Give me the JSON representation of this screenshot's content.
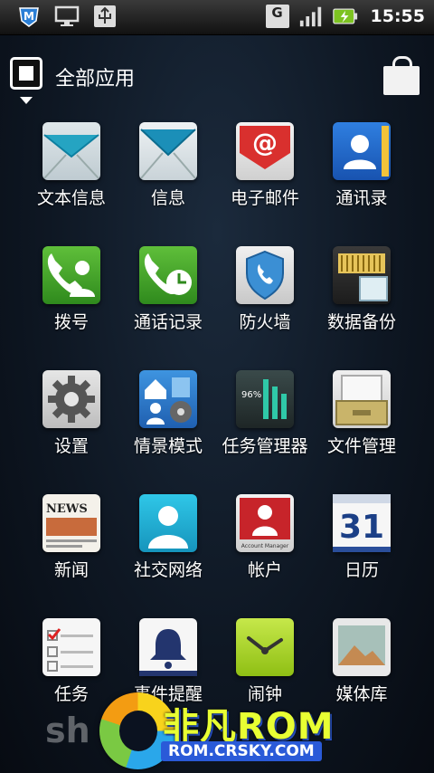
{
  "status_bar": {
    "clock": "15:55",
    "network_badge": "G",
    "icons": [
      "moto-m-icon",
      "monitor-icon",
      "usb-icon",
      "g-network-icon",
      "signal-icon",
      "battery-charging-icon"
    ]
  },
  "header": {
    "title": "全部应用"
  },
  "apps": [
    {
      "label": "文本信息",
      "icon": "envelope-teal-icon"
    },
    {
      "label": "信息",
      "icon": "envelope-icon"
    },
    {
      "label": "电子邮件",
      "icon": "email-at-icon"
    },
    {
      "label": "通讯录",
      "icon": "contacts-book-icon"
    },
    {
      "label": "拨号",
      "icon": "phone-dialer-icon"
    },
    {
      "label": "通话记录",
      "icon": "call-log-icon"
    },
    {
      "label": "防火墙",
      "icon": "firewall-shield-icon"
    },
    {
      "label": "数据备份",
      "icon": "sd-card-backup-icon"
    },
    {
      "label": "设置",
      "icon": "settings-gear-icon"
    },
    {
      "label": "情景模式",
      "icon": "profiles-icon"
    },
    {
      "label": "任务管理器",
      "icon": "task-manager-icon"
    },
    {
      "label": "文件管理",
      "icon": "file-drawer-icon"
    },
    {
      "label": "新闻",
      "icon": "news-icon"
    },
    {
      "label": "社交网络",
      "icon": "social-network-icon"
    },
    {
      "label": "帐户",
      "icon": "account-icon"
    },
    {
      "label": "日历",
      "icon": "calendar-icon"
    },
    {
      "label": "任务",
      "icon": "tasks-checklist-icon"
    },
    {
      "label": "事件提醒",
      "icon": "reminder-bell-icon"
    },
    {
      "label": "闹钟",
      "icon": "alarm-clock-icon"
    },
    {
      "label": "媒体库",
      "icon": "media-gallery-icon"
    }
  ],
  "icon_text": {
    "news": "NEWS",
    "calendar_day": "31",
    "taskmgr_pct": "96%",
    "account_caption": "Account Manager",
    "email_symbol": "@"
  },
  "watermark": {
    "title": "非凡ROM",
    "url": "ROM.CRSKY.COM",
    "ghost": "sh"
  }
}
